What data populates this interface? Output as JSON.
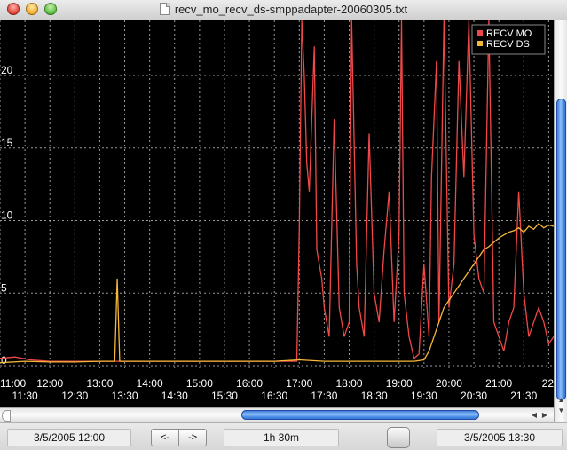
{
  "window": {
    "title": "recv_mo_recv_ds-smppadapter-20060305.txt",
    "file_icon": "text-document-icon"
  },
  "chart_data": {
    "type": "line",
    "legend": {
      "placement": "top-right",
      "entries": [
        "RECV MO",
        "RECV DS"
      ]
    },
    "y_ticks": [
      "0",
      "5",
      "10",
      "15",
      "20"
    ],
    "ylim": [
      0,
      24
    ],
    "x_ticks_upper": [
      "11:00",
      "12:00",
      "13:00",
      "14:00",
      "15:00",
      "16:00",
      "17:00",
      "18:00",
      "19:00",
      "20:00",
      "21:00",
      "22"
    ],
    "x_ticks_lower": [
      "11:30",
      "12:30",
      "13:30",
      "14:30",
      "15:30",
      "16:30",
      "17:30",
      "18:30",
      "19:30",
      "20:30",
      "21:30"
    ],
    "xlim_hours": [
      11.0,
      22.1
    ],
    "grid": true,
    "colors": {
      "RECV MO": "#f04848",
      "RECV DS": "#f4b73a"
    },
    "series": [
      {
        "name": "RECV MO",
        "x": [
          11.0,
          11.3,
          11.6,
          12.0,
          12.5,
          13.0,
          13.4,
          14.0,
          14.5,
          15.0,
          15.5,
          16.0,
          16.5,
          16.95,
          17.0,
          17.05,
          17.1,
          17.15,
          17.2,
          17.3,
          17.35,
          17.45,
          17.5,
          17.6,
          17.7,
          17.8,
          17.9,
          18.0,
          18.05,
          18.15,
          18.2,
          18.3,
          18.4,
          18.5,
          18.6,
          18.7,
          18.8,
          18.9,
          19.0,
          19.05,
          19.1,
          19.2,
          19.3,
          19.4,
          19.5,
          19.6,
          19.65,
          19.75,
          19.8,
          19.9,
          20.0,
          20.1,
          20.2,
          20.3,
          20.4,
          20.5,
          20.6,
          20.7,
          20.8,
          20.9,
          21.0,
          21.1,
          21.2,
          21.3,
          21.4,
          21.5,
          21.6,
          21.7,
          21.8,
          21.9,
          22.0,
          22.1
        ],
        "y": [
          0.5,
          0.6,
          0.4,
          0.3,
          0.3,
          0.3,
          0.3,
          0.3,
          0.3,
          0.3,
          0.3,
          0.3,
          0.3,
          0.3,
          9.5,
          24,
          20,
          14,
          12,
          22,
          8,
          6,
          4,
          2,
          17,
          4,
          2,
          3,
          24,
          7,
          4,
          2,
          16,
          5,
          3,
          8,
          12,
          3,
          9,
          24,
          5,
          2,
          0.5,
          0.8,
          7,
          2,
          13,
          21,
          3,
          24,
          4,
          7,
          21,
          13,
          24,
          9,
          6,
          5,
          24,
          3,
          2,
          1,
          3,
          4,
          12,
          5,
          2,
          3,
          4,
          3,
          1.5,
          2
        ]
      },
      {
        "name": "RECV DS",
        "x": [
          11.0,
          11.5,
          12.0,
          12.5,
          13.0,
          13.2,
          13.3,
          13.35,
          13.4,
          13.5,
          14.0,
          14.5,
          15.0,
          15.5,
          16.0,
          16.5,
          17.0,
          17.5,
          18.0,
          18.5,
          19.0,
          19.3,
          19.5,
          19.6,
          19.7,
          19.8,
          19.9,
          20.0,
          20.1,
          20.2,
          20.3,
          20.4,
          20.5,
          20.6,
          20.7,
          20.8,
          20.9,
          21.0,
          21.1,
          21.2,
          21.3,
          21.4,
          21.5,
          21.6,
          21.7,
          21.8,
          21.9,
          22.0,
          22.1
        ],
        "y": [
          0.2,
          0.3,
          0.25,
          0.25,
          0.3,
          0.3,
          0.3,
          6,
          0.3,
          0.3,
          0.3,
          0.3,
          0.3,
          0.3,
          0.3,
          0.3,
          0.4,
          0.3,
          0.3,
          0.3,
          0.3,
          0.3,
          0.4,
          1,
          2,
          3,
          4,
          4.5,
          5,
          5.5,
          6,
          6.5,
          7,
          7.5,
          8,
          8.2,
          8.5,
          8.8,
          9,
          9.2,
          9.3,
          9.5,
          9.2,
          9.6,
          9.4,
          9.8,
          9.5,
          9.7,
          9.6
        ]
      }
    ]
  },
  "bottom_bar": {
    "start_time": "3/5/2005 12:00",
    "back_button": "<-",
    "forward_button": "->",
    "duration": "1h 30m",
    "end_time": "3/5/2005 13:30"
  }
}
